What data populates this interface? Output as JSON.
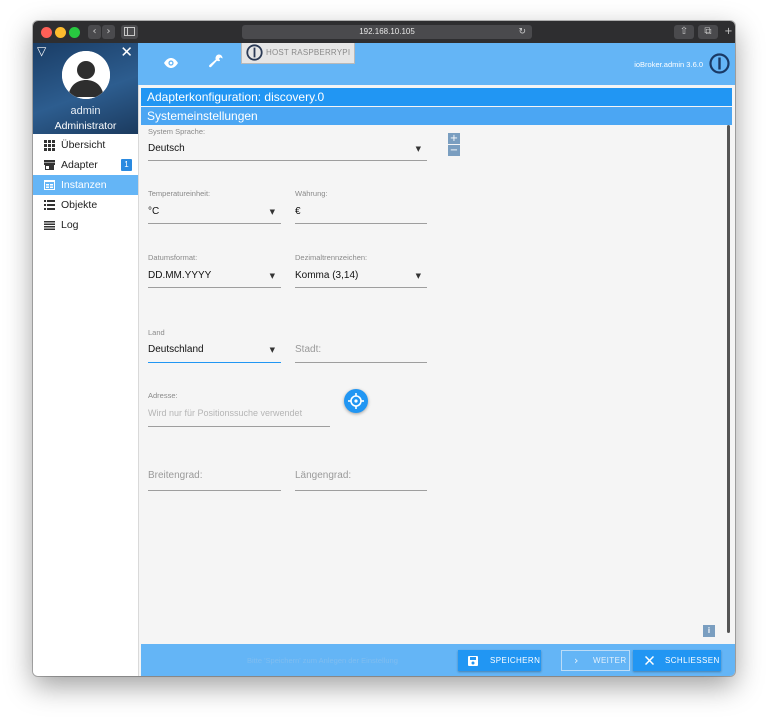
{
  "browser": {
    "url": "192.168.10.105",
    "reload_glyph": "↻",
    "nav_back": "‹",
    "nav_forward": "›",
    "share_glyph": "⇧",
    "tabs_glyph": "⧉",
    "new_tab_glyph": "+"
  },
  "sidebar": {
    "collapse_glyph": "▽",
    "close_glyph": "✕",
    "user_name": "admin",
    "user_role": "Administrator",
    "items": [
      {
        "label": "Übersicht",
        "icon": "grid-icon",
        "active": false
      },
      {
        "label": "Adapter",
        "icon": "store-icon",
        "active": false,
        "badge": "1"
      },
      {
        "label": "Instanzen",
        "icon": "instances-icon",
        "active": true
      },
      {
        "label": "Objekte",
        "icon": "list-icon",
        "active": false
      },
      {
        "label": "Log",
        "icon": "log-icon",
        "active": false
      }
    ]
  },
  "header": {
    "host": "HOST RASPBERRYPI",
    "version": "ioBroker.admin 3.6.0"
  },
  "panel": {
    "title": "Adapterkonfiguration: discovery.0",
    "section": "Systemeinstellungen"
  },
  "form": {
    "language": {
      "label": "System Sprache:",
      "value": "Deutsch"
    },
    "temperature": {
      "label": "Temperatureinheit:",
      "value": "°C"
    },
    "currency": {
      "label": "Währung:",
      "value": "€"
    },
    "date_format": {
      "label": "Datumsformat:",
      "value": "DD.MM.YYYY"
    },
    "decimal": {
      "label": "Dezimaltrennzeichen:",
      "value": "Komma (3,14)"
    },
    "country": {
      "label": "Land",
      "value": "Deutschland"
    },
    "city": {
      "placeholder": "Stadt:"
    },
    "address": {
      "label": "Adresse:",
      "placeholder": "Wird nur für Positionssuche verwendet"
    },
    "latitude": {
      "placeholder": "Breitengrad:"
    },
    "longitude": {
      "placeholder": "Längengrad:"
    }
  },
  "map_zoom": {
    "plus": "+",
    "minus": "−"
  },
  "info_label": "i",
  "footer": {
    "hint": "Bitte 'Speichern' zum Anlegen der Einstellung",
    "save": "SPEICHERN",
    "next": "WEITER",
    "close": "SCHLIESSEN"
  },
  "colors": {
    "primary": "#2196f3",
    "header": "#64b5f6",
    "active_nav": "#64b5f6"
  }
}
